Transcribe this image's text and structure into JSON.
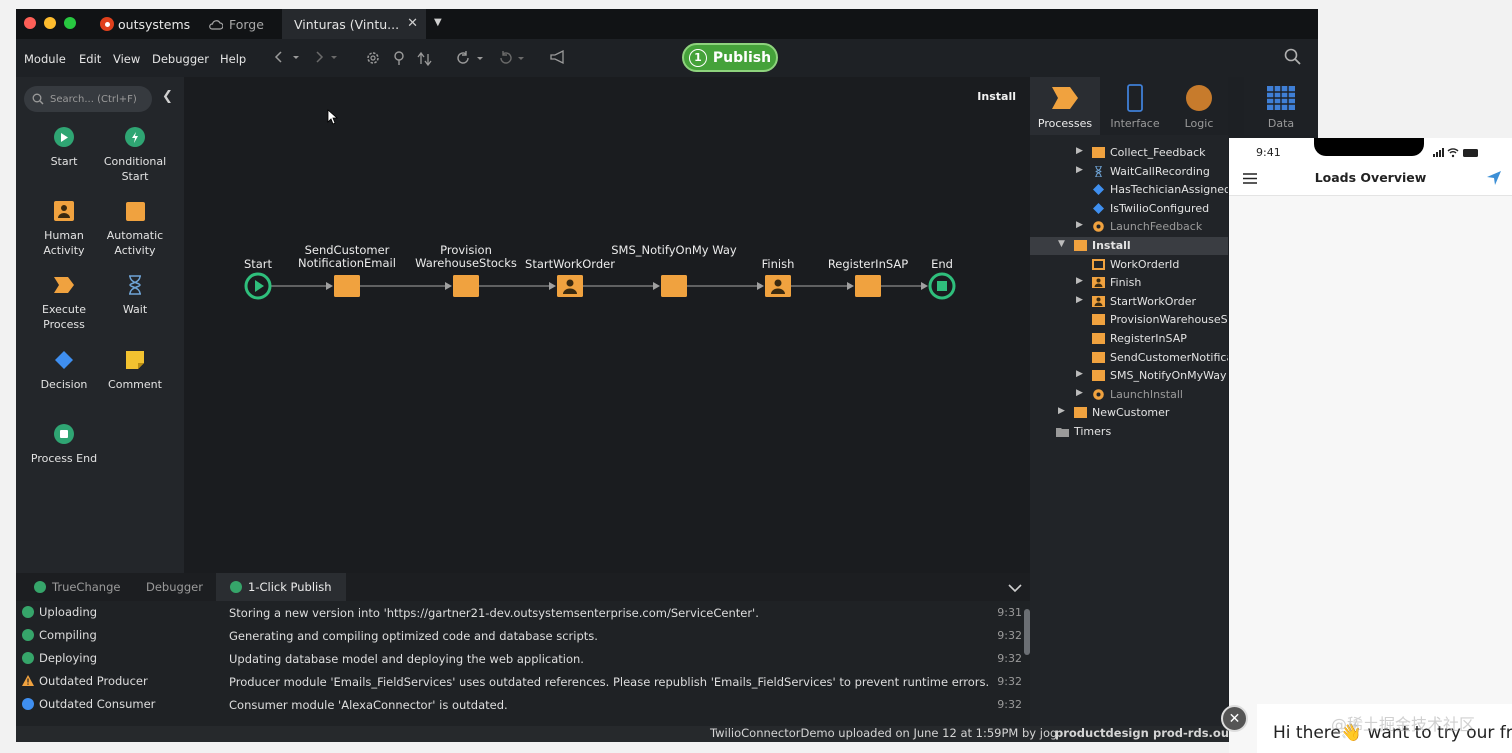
{
  "titlebar": {
    "brand": "outsystems",
    "tabs": [
      {
        "label": "Forge"
      },
      {
        "label": "Vinturas (Vintu..."
      }
    ],
    "close_glyph": "✕",
    "add_glyph": "▼"
  },
  "menubar": {
    "items": [
      "Module",
      "Edit",
      "View",
      "Debugger",
      "Help"
    ],
    "publish": {
      "number": "1",
      "label": "Publish",
      "color": "#45a23a"
    }
  },
  "toolbox": {
    "search_placeholder": "Search... (Ctrl+F)",
    "tools": [
      {
        "label": "Start",
        "icon": "start-icon"
      },
      {
        "label": "Conditional Start",
        "icon": "conditional-start-icon"
      },
      {
        "label": "Human Activity",
        "icon": "human-activity-icon"
      },
      {
        "label": "Automatic Activity",
        "icon": "automatic-activity-icon"
      },
      {
        "label": "Execute Process",
        "icon": "execute-process-icon"
      },
      {
        "label": "Wait",
        "icon": "hourglass-icon"
      },
      {
        "label": "Decision",
        "icon": "decision-diamond-icon"
      },
      {
        "label": "Comment",
        "icon": "comment-icon"
      },
      {
        "label": "Process End",
        "icon": "process-end-icon"
      }
    ]
  },
  "canvas": {
    "title": "Install",
    "nodes": [
      {
        "label": "Start",
        "type": "start"
      },
      {
        "label": "SendCustomer NotificationEmail",
        "type": "automatic"
      },
      {
        "label": "Provision WarehouseStocks",
        "type": "automatic"
      },
      {
        "label": "StartWorkOrder",
        "type": "human"
      },
      {
        "label": "SMS_NotifyOnMy Way",
        "type": "automatic"
      },
      {
        "label": "Finish",
        "type": "human"
      },
      {
        "label": "RegisterInSAP",
        "type": "automatic"
      },
      {
        "label": "End",
        "type": "end"
      }
    ]
  },
  "bottom": {
    "tabs": [
      "TrueChange",
      "Debugger",
      "1-Click Publish"
    ],
    "log": [
      {
        "status": "Uploading",
        "type": "ok",
        "message": "Storing a new version into 'https://gartner21-dev.outsystemsenterprise.com/ServiceCenter'.",
        "time": "9:31"
      },
      {
        "status": "Compiling",
        "type": "ok",
        "message": "Generating and compiling optimized code and database scripts.",
        "time": "9:32"
      },
      {
        "status": "Deploying",
        "type": "ok",
        "message": "Updating database model and deploying the web application.",
        "time": "9:32"
      },
      {
        "status": "Outdated Producer",
        "type": "warn",
        "message": "Producer module 'Emails_FieldServices' uses outdated references. Please republish 'Emails_FieldServices' to prevent runtime errors.",
        "time": "9:32"
      },
      {
        "status": "Outdated Consumer",
        "type": "info",
        "message": "Consumer module 'AlexaConnector' is outdated.",
        "time": "9:32"
      }
    ]
  },
  "statusbar": {
    "upload_info": "TwilioConnectorDemo uploaded on June 12 at 1:59PM by jog",
    "team": "productdesign",
    "server": "prod-rds.outs"
  },
  "right_panel": {
    "tabs": [
      "Processes",
      "Interface",
      "Logic",
      "Data"
    ],
    "tree": [
      {
        "label": "Collect_Feedback",
        "icon": "process-icon",
        "expand": true,
        "indent": 1
      },
      {
        "label": "WaitCallRecording",
        "icon": "hourglass-icon",
        "expand": true,
        "indent": 1
      },
      {
        "label": "HasTechicianAssigned",
        "icon": "decision-icon",
        "expand": false,
        "indent": 1
      },
      {
        "label": "IsTwilioConfigured",
        "icon": "decision-icon",
        "expand": false,
        "indent": 1
      },
      {
        "label": "LaunchFeedback",
        "icon": "launch-icon",
        "expand": true,
        "indent": 1,
        "dim": true
      },
      {
        "label": "Install",
        "icon": "process-icon",
        "expand": true,
        "open": true,
        "indent": 0,
        "selected": true
      },
      {
        "label": "WorkOrderId",
        "icon": "variable-icon",
        "expand": false,
        "indent": 1
      },
      {
        "label": "Finish",
        "icon": "human-activity-icon",
        "expand": true,
        "indent": 1
      },
      {
        "label": "StartWorkOrder",
        "icon": "human-activity-icon",
        "expand": true,
        "indent": 1
      },
      {
        "label": "ProvisionWarehouseSt",
        "icon": "automatic-activity-icon",
        "expand": false,
        "indent": 1
      },
      {
        "label": "RegisterInSAP",
        "icon": "automatic-activity-icon",
        "expand": false,
        "indent": 1
      },
      {
        "label": "SendCustomerNotifica",
        "icon": "automatic-activity-icon",
        "expand": false,
        "indent": 1
      },
      {
        "label": "SMS_NotifyOnMyWay",
        "icon": "automatic-activity-icon",
        "expand": true,
        "indent": 1
      },
      {
        "label": "LaunchInstall",
        "icon": "launch-icon",
        "expand": true,
        "indent": 1,
        "dim": true
      },
      {
        "label": "NewCustomer",
        "icon": "process-icon",
        "expand": true,
        "indent": 0
      },
      {
        "label": "Timers",
        "icon": "folder-icon",
        "expand": false,
        "indent": -1
      }
    ]
  },
  "phone": {
    "time": "9:41",
    "title": "Loads Overview"
  },
  "chat": {
    "text_before": "Hi there",
    "emoji": "👋",
    "text_after": " want to try our fr"
  },
  "watermark": "@稀土掘金技术社区",
  "colors": {
    "accent_orange": "#f0a23f",
    "accent_green": "#2fa573",
    "publish_green": "#45a23a"
  }
}
